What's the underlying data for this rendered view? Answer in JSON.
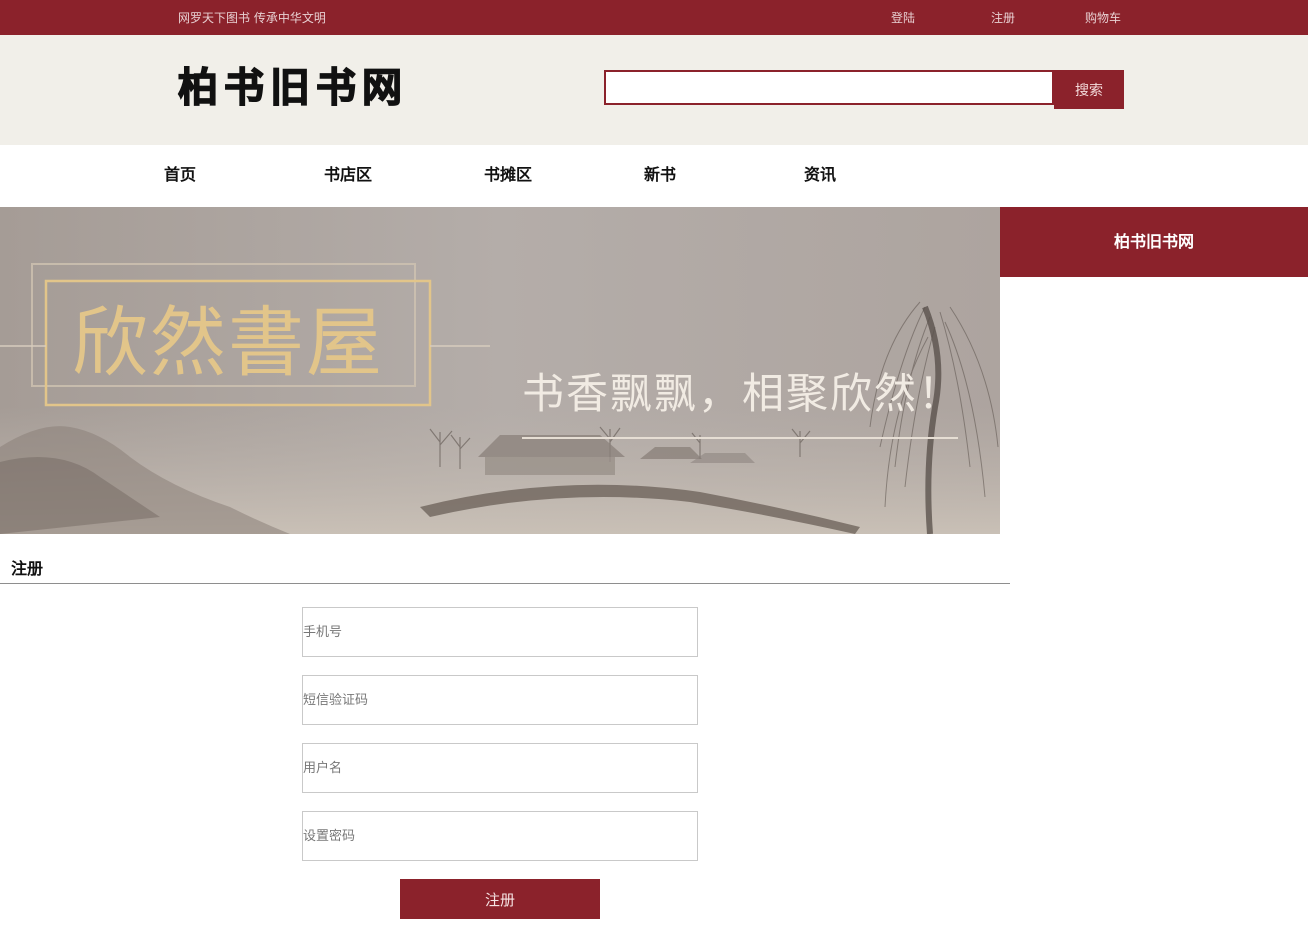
{
  "topbar": {
    "slogan": "网罗天下图书  传承中华文明",
    "links": {
      "login": "登陆",
      "register": "注册",
      "cart": "购物车"
    }
  },
  "header": {
    "logo_text": "柏书旧书网",
    "search": {
      "placeholder": "",
      "button_label": "搜索"
    }
  },
  "nav": {
    "items": [
      {
        "label": "首页"
      },
      {
        "label": "书店区"
      },
      {
        "label": "书摊区"
      },
      {
        "label": "新书"
      },
      {
        "label": "资讯"
      }
    ]
  },
  "banner": {
    "title": "欣然書屋",
    "tagline": "书香飘飘，相聚欣然！"
  },
  "sidebar": {
    "title": "柏书旧书网"
  },
  "register": {
    "section_title": "注册",
    "fields": [
      {
        "placeholder": "手机号"
      },
      {
        "placeholder": "短信验证码"
      },
      {
        "placeholder": "用户名"
      },
      {
        "placeholder": "设置密码"
      }
    ],
    "submit_label": "注册"
  },
  "colors": {
    "brand": "#8b222b",
    "header_bg": "#f1efe9",
    "banner_gold": "#e2c58a"
  }
}
